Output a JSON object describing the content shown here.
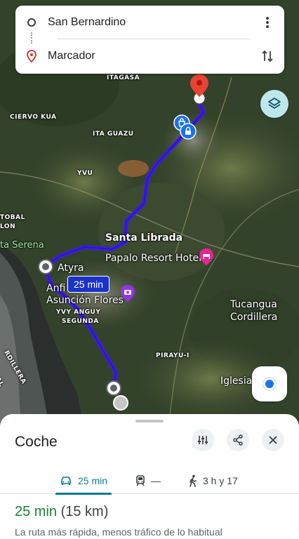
{
  "search": {
    "origin": "San Bernardino",
    "destination": "Marcador"
  },
  "map": {
    "labels": {
      "itagasa": "ITAGASA",
      "ciervo_kua": "CIERVO KUA",
      "ita_guazu": "ITA GUAZU",
      "yvu": "YVU",
      "tobal": "TOBAL",
      "lon": "LON",
      "ta_serena": "ta Serena",
      "santa_librada": "Santa Librada",
      "papalo": "Papalo Resort Hotel",
      "atyra": "Atyra",
      "anfi": "Anfi",
      "asuncion_flores": "Asunción Flores",
      "yvy_anguy": "YVY ANGUY",
      "segunda": "SEGUNDA",
      "tucangua": "Tucangua",
      "cordillera": "Cordillera",
      "pirayu": "PIRAYU-I",
      "iglesia": "Iglesia",
      "cordillera_vert": "RDILLERA",
      "al": "AL"
    },
    "eta_badge": "25 min",
    "route_color": "#3b1de0"
  },
  "sheet": {
    "mode_title": "Coche",
    "tabs": [
      {
        "icon": "car-icon",
        "label": "25 min"
      },
      {
        "icon": "train-icon",
        "label": "—"
      },
      {
        "icon": "walk-icon",
        "label": "3 h y 17"
      }
    ],
    "summary_time": "25 min",
    "summary_dist": "(15 km)",
    "subtext": "La ruta más rápida, menos tráfico de lo habitual"
  },
  "colors": {
    "accent": "#0b7a8f",
    "route": "#3b1de0",
    "time_green": "#188038"
  }
}
